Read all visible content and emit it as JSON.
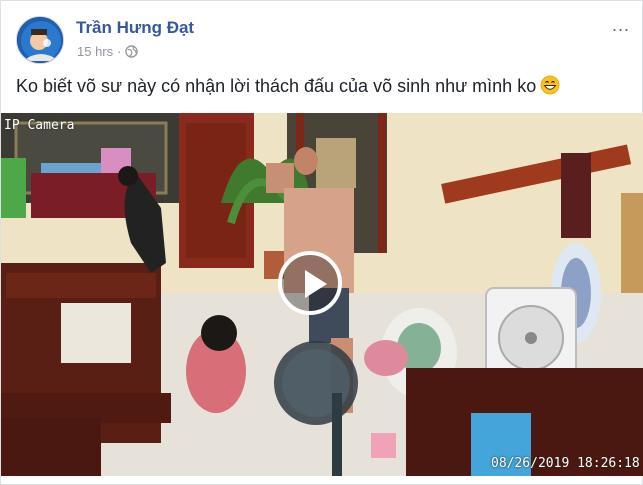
{
  "post": {
    "author": "Trần Hưng Đạt",
    "time": "15 hrs",
    "separator": "·",
    "more_label": "...",
    "text": "Ko biết võ sư này có nhận lời thách đấu của võ sinh như mình ko",
    "emoji": "grinning-face-emoji"
  },
  "video": {
    "camera_label": "IP Camera",
    "timestamp": "08/26/2019  18:26:18",
    "play_icon": "play-icon"
  },
  "colors": {
    "author_link": "#385898",
    "meta_gray": "#90949c",
    "text": "#1d2129"
  }
}
